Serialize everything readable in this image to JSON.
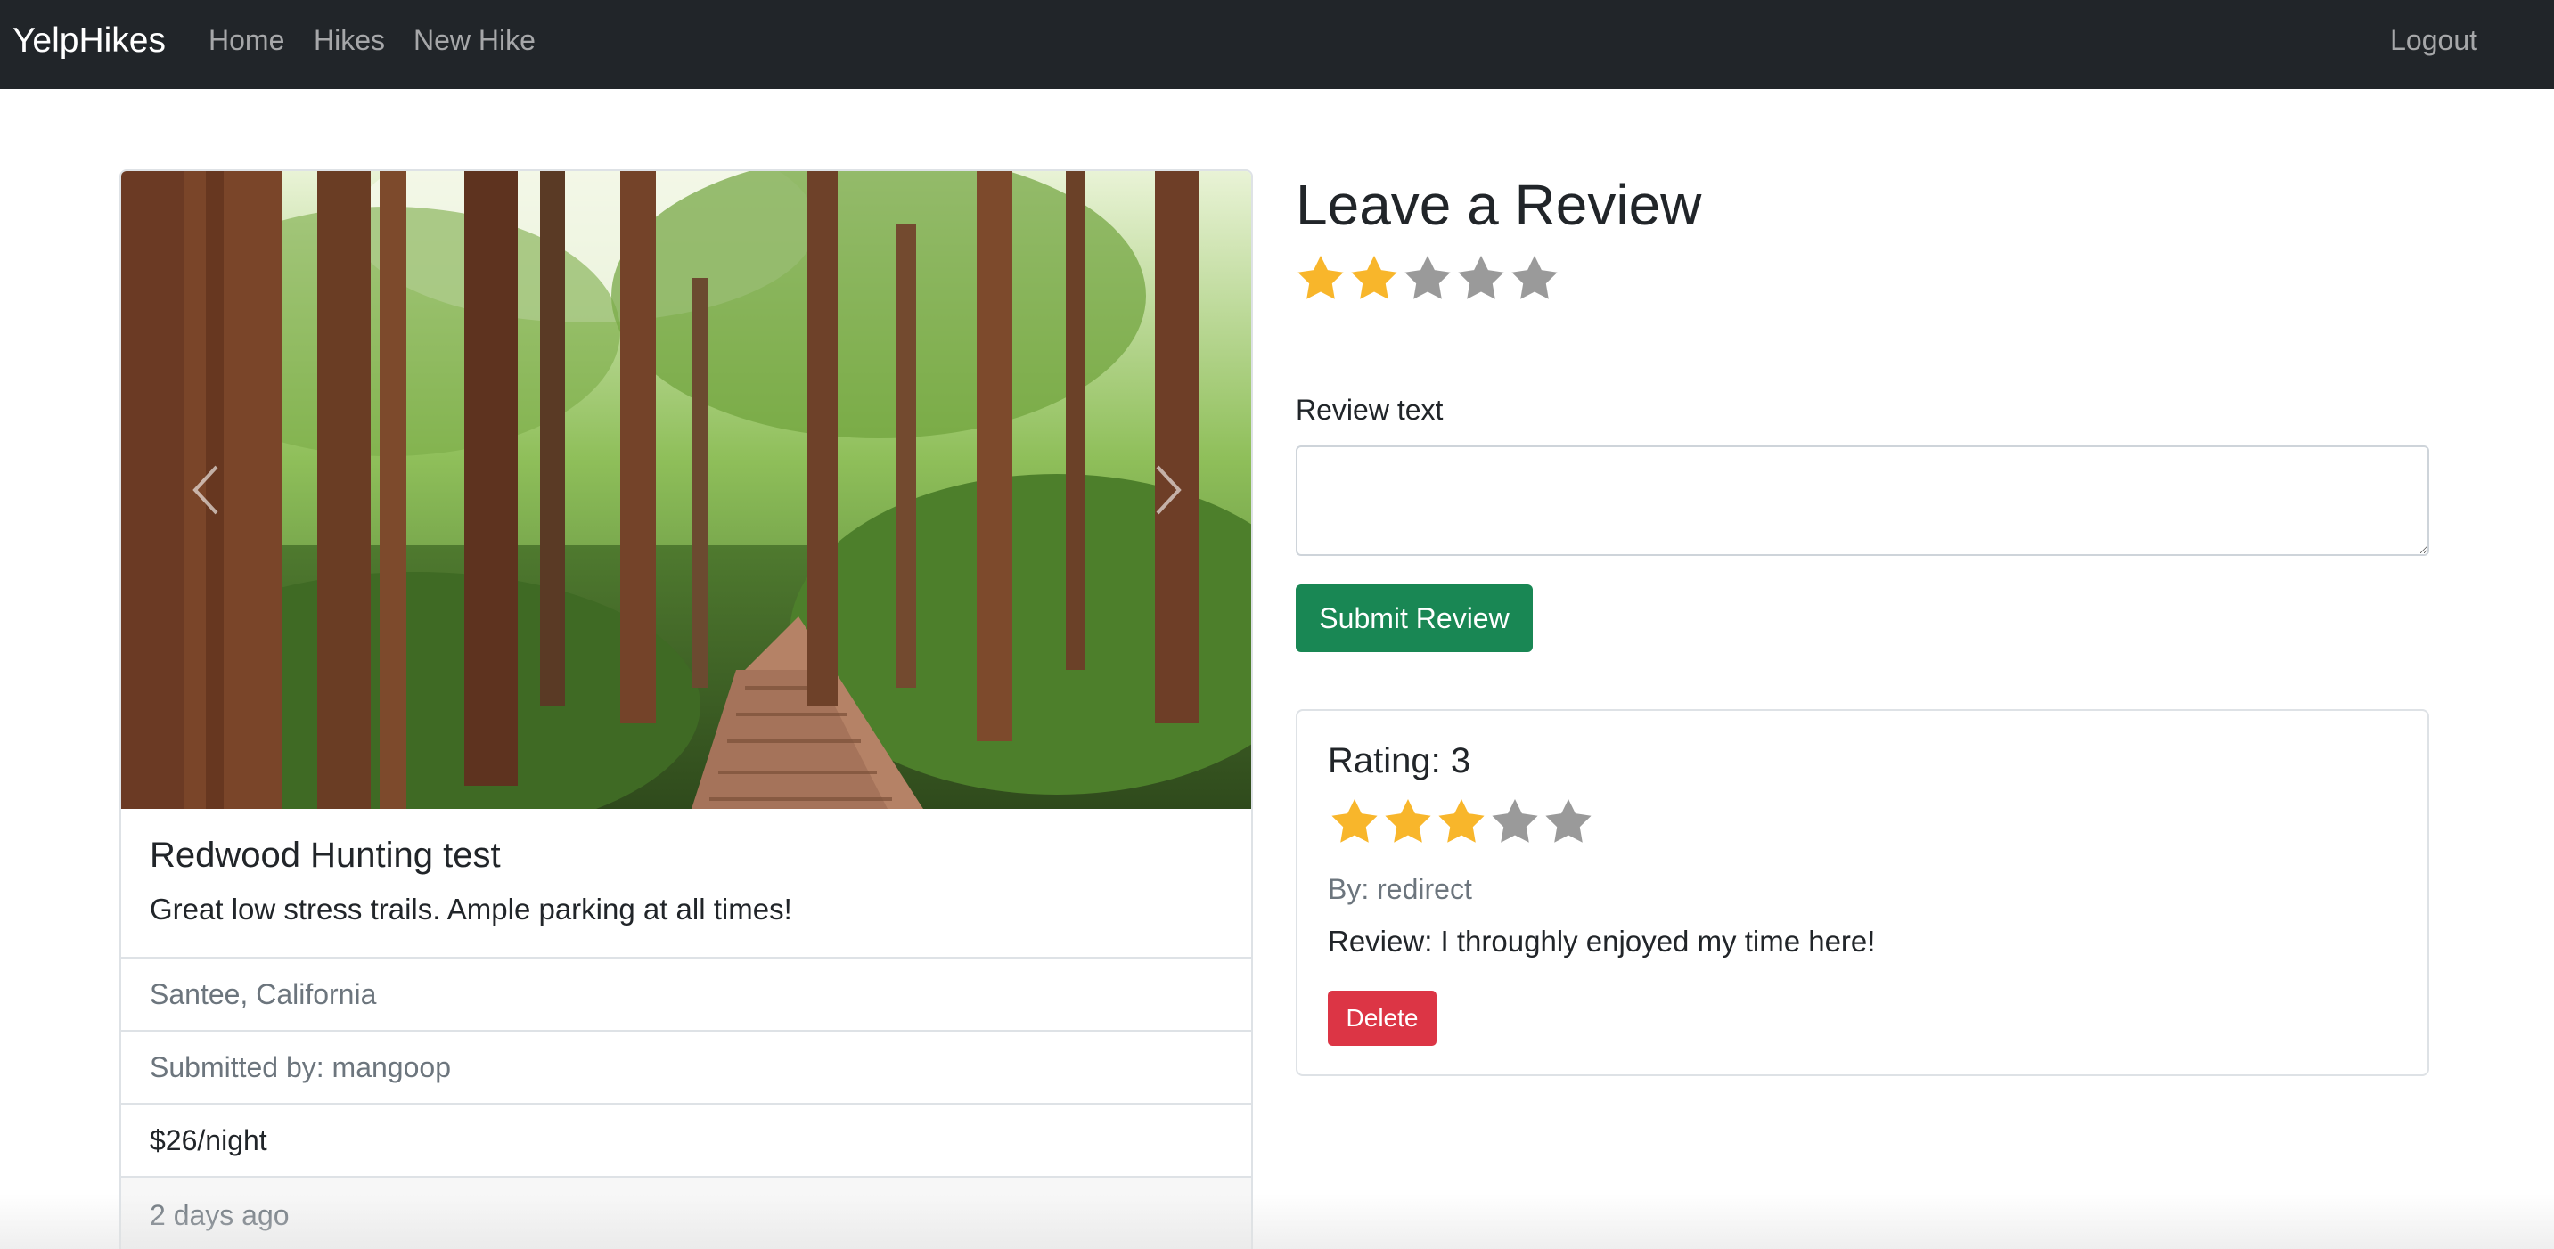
{
  "navbar": {
    "brand": "YelpHikes",
    "links": [
      "Home",
      "Hikes",
      "New Hike"
    ],
    "logout": "Logout"
  },
  "hike": {
    "title": "Redwood Hunting test",
    "description": "Great low stress trails. Ample parking at all times!",
    "location": "Santee, California",
    "submitted_by": "Submitted by: mangoop",
    "price": "$26/night",
    "posted": "2 days ago"
  },
  "review_form": {
    "heading": "Leave a Review",
    "star_rating": 2,
    "star_max": 5,
    "label": "Review text",
    "textarea_value": "",
    "submit_label": "Submit Review"
  },
  "reviews": [
    {
      "rating_title": "Rating: 3",
      "rating": 3,
      "author": "By: redirect",
      "text": "Review: I throughly enjoyed my time here!",
      "delete_label": "Delete"
    }
  ],
  "colors": {
    "navbar_bg": "#212529",
    "star_filled": "#f8b62b",
    "star_empty": "#9a9a9a",
    "success": "#198754",
    "danger": "#dc3545"
  },
  "icons": [
    "chevron-left-icon",
    "chevron-right-icon",
    "star-icon"
  ]
}
